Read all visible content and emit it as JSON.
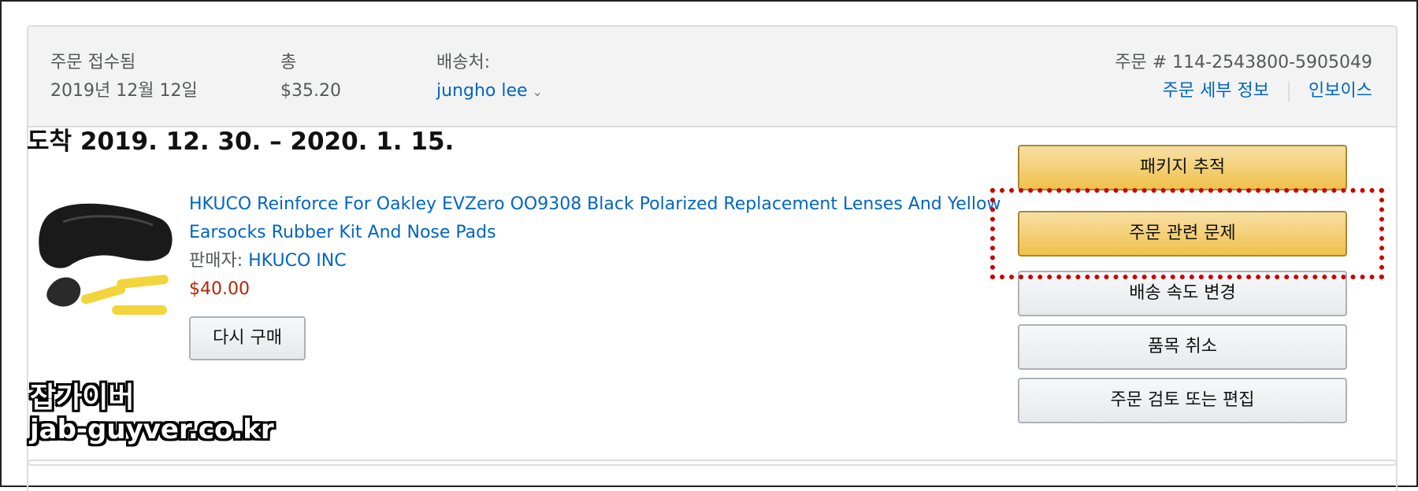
{
  "header": {
    "order_placed_label": "주문 접수됨",
    "order_placed_value": "2019년 12월 12일",
    "total_label": "총",
    "total_value": "$35.20",
    "ship_to_label": "배송처:",
    "ship_to_value": "jungho lee",
    "order_number": "주문 # 114-2543800-5905049",
    "order_details_link": "주문 세부 정보",
    "invoice_link": "인보이스"
  },
  "shipment": {
    "arrival": "도착 2019. 12. 30. – 2020. 1. 15."
  },
  "item": {
    "title": "HKUCO Reinforce For Oakley EVZero OO9308 Black Polarized Replacement Lenses And Yellow Earsocks Rubber Kit And Nose Pads",
    "seller_label": "판매자: ",
    "seller_name": "HKUCO INC",
    "price": "$40.00",
    "buy_again_label": "다시 구매"
  },
  "actions": {
    "track_package": "패키지 추적",
    "problem_with_order": "주문 관련 문제",
    "change_speed": "배송 속도 변경",
    "cancel_items": "품목 취소",
    "review_or_edit": "주문 검토 또는 편집"
  },
  "watermark": {
    "line1": "잡가이버",
    "line2": "jab-guyver.co.kr"
  },
  "colors": {
    "link": "#0066c0",
    "price": "#b12704",
    "primary_button": "#f0c14b",
    "highlight": "#cc0000"
  },
  "icons": {
    "chevron": "chevron-down-icon"
  }
}
